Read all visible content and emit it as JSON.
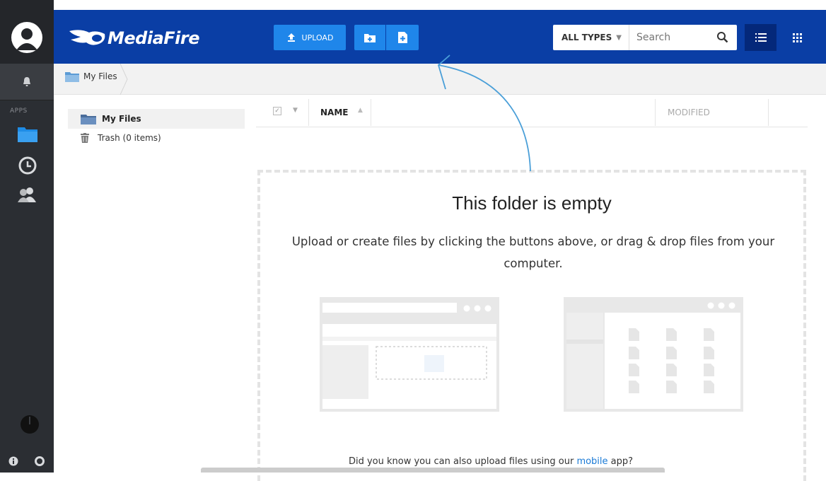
{
  "app": {
    "logo_text": "MediaFire"
  },
  "toolbar": {
    "upload_label": "UPLOAD",
    "filter_label": "ALL TYPES",
    "search_placeholder": "Search"
  },
  "sidebar": {
    "apps_label": "APPS"
  },
  "breadcrumb": {
    "current": "My Files"
  },
  "tree": {
    "my_files": "My Files",
    "trash": "Trash (0 items)"
  },
  "columns": {
    "name": "NAME",
    "modified": "MODIFIED"
  },
  "empty": {
    "title": "This folder is empty",
    "text": "Upload or create files by clicking the buttons above, or drag & drop files from your computer.",
    "tip_before": "Did you know you can also upload files using our ",
    "tip_link": "mobile",
    "tip_after": " app?"
  },
  "colors": {
    "brand_blue": "#0a3ea5",
    "button_blue": "#1f86ea",
    "rail_dark": "#2b2e33",
    "folder_blue": "#1e8ce6"
  }
}
